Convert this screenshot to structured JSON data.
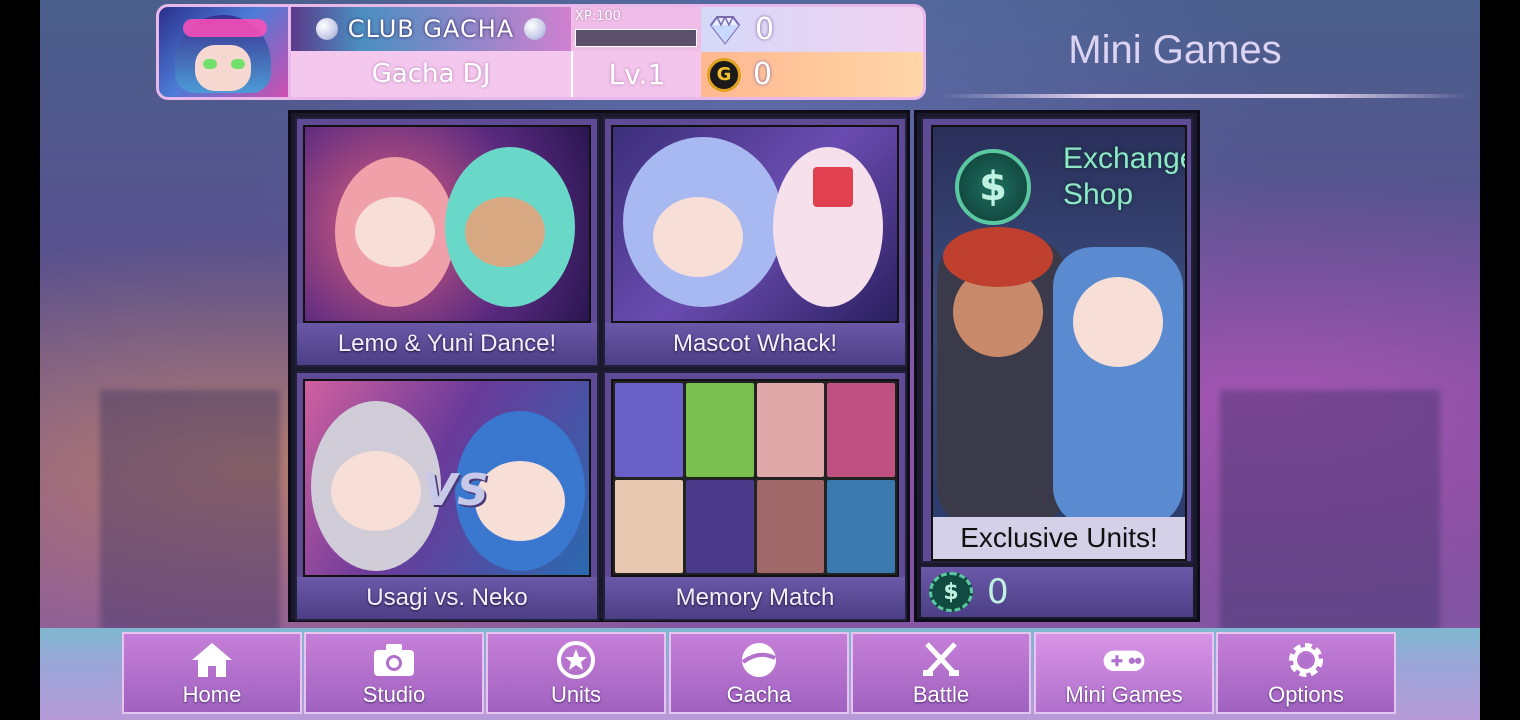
{
  "player": {
    "club_title": "CLUB GACHA",
    "name": "Gacha DJ",
    "xp_label": "XP:100",
    "xp_fraction": 0.0,
    "level": "Lv.1",
    "gems": "0",
    "gold": "0"
  },
  "screen": {
    "title": "Mini Games"
  },
  "games": [
    {
      "label": "Lemo & Yuni Dance!"
    },
    {
      "label": "Mascot Whack!"
    },
    {
      "label": "Usagi vs. Neko",
      "vs_text": "VS"
    },
    {
      "label": "Memory Match"
    }
  ],
  "shop": {
    "title_line1": "Exchange",
    "title_line2": "Shop",
    "subtitle": "Exclusive Units!",
    "balance": "0",
    "icon_symbol": "$"
  },
  "nav": {
    "items": [
      {
        "label": "Home",
        "icon": "home-icon"
      },
      {
        "label": "Studio",
        "icon": "camera-icon"
      },
      {
        "label": "Units",
        "icon": "star-icon"
      },
      {
        "label": "Gacha",
        "icon": "gacha-ball-icon"
      },
      {
        "label": "Battle",
        "icon": "crossed-swords-icon"
      },
      {
        "label": "Mini Games",
        "icon": "gamepad-icon"
      },
      {
        "label": "Options",
        "icon": "gear-icon"
      }
    ],
    "active": "Mini Games"
  },
  "colors": {
    "accent_pink": "#f3c4ec",
    "card_purple": "#5f4a96",
    "shop_green": "#8ee8c8"
  }
}
